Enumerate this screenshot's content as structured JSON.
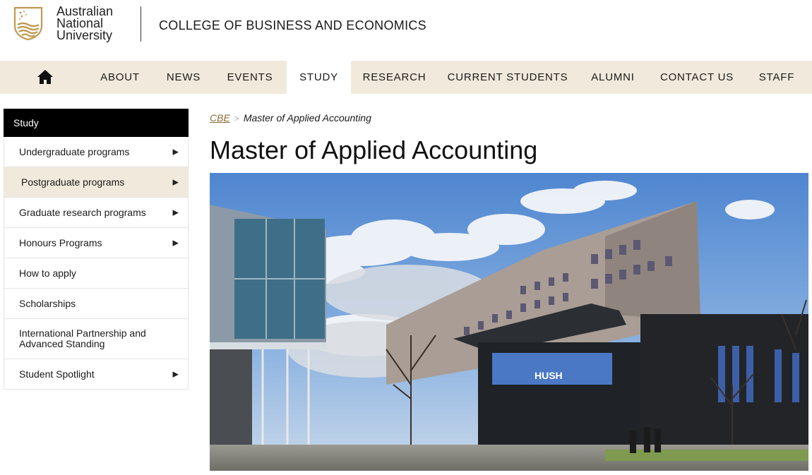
{
  "brand": {
    "line1": "Australian",
    "line2": "National",
    "line3": "University",
    "college": "COLLEGE OF BUSINESS AND ECONOMICS",
    "crest_color": "#be9b53"
  },
  "nav": {
    "home_icon": "home-icon",
    "items": [
      {
        "label": "ABOUT"
      },
      {
        "label": "NEWS"
      },
      {
        "label": "EVENTS"
      },
      {
        "label": "STUDY",
        "active": true
      },
      {
        "label": "RESEARCH"
      },
      {
        "label": "CURRENT STUDENTS"
      },
      {
        "label": "ALUMNI"
      },
      {
        "label": "CONTACT US"
      },
      {
        "label": "STAFF"
      }
    ],
    "bg_color": "#f1eadc"
  },
  "sidebar": {
    "heading": "Study",
    "items": [
      {
        "label": "Undergraduate programs",
        "arrow": "▶"
      },
      {
        "label": "Postgraduate programs",
        "arrow": "▶",
        "active": true
      },
      {
        "label": "Graduate research programs",
        "arrow": "▶"
      },
      {
        "label": "Honours Programs",
        "arrow": "▶"
      },
      {
        "label": "How to apply"
      },
      {
        "label": "Scholarships"
      },
      {
        "label": "International Partnership and Advanced Standing"
      },
      {
        "label": "Student Spotlight",
        "arrow": "▶"
      }
    ]
  },
  "breadcrumb": {
    "root": "CBE",
    "separator": ">",
    "current": "Master of Applied Accounting"
  },
  "page": {
    "title": "Master of Applied Accounting"
  },
  "hero": {
    "signage": "HUSH"
  }
}
